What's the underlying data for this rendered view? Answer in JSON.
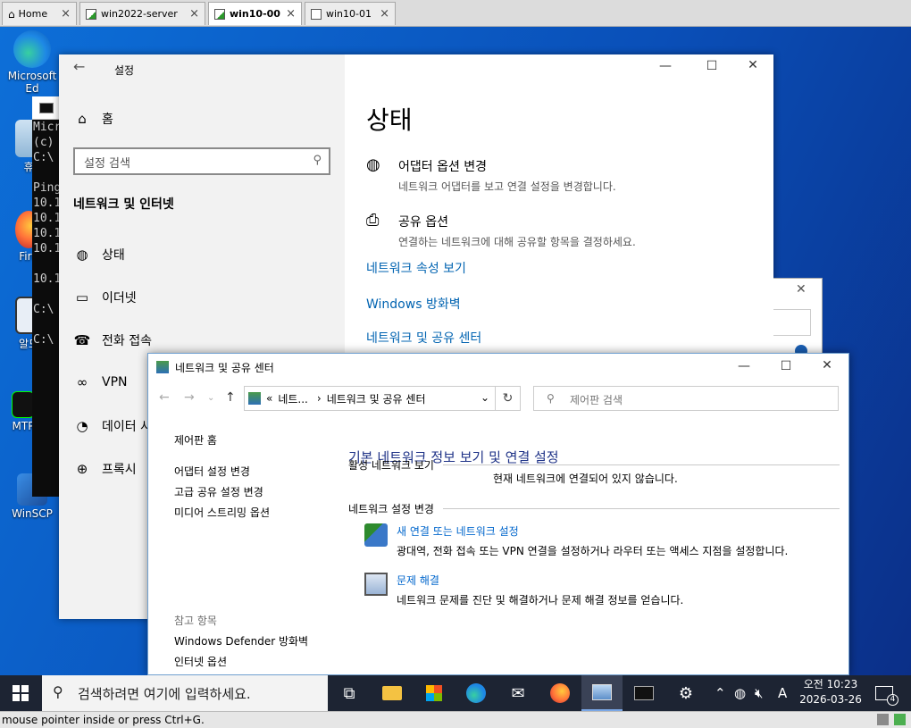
{
  "vm_tabs": [
    {
      "label": "Home"
    },
    {
      "label": "win2022-server"
    },
    {
      "label": "win10-00"
    },
    {
      "label": "win10-01"
    }
  ],
  "desktop_icons": [
    {
      "label": "Microsoft Ed"
    },
    {
      "label": "휴"
    },
    {
      "label": "Fire"
    },
    {
      "label": "알드"
    },
    {
      "label": "MTP"
    },
    {
      "label": "WinSCP"
    }
  ],
  "cmd": {
    "lines": [
      "Micr",
      "(c)",
      "C:\\",
      "",
      "Ping",
      "10.1",
      "10.1",
      "10.1",
      "10.1",
      "",
      "10.1",
      "",
      "C:\\",
      "",
      "C:\\"
    ]
  },
  "settings": {
    "title": "설정",
    "home": "홈",
    "search_placeholder": "설정 검색",
    "section": "네트워크 및 인터넷",
    "nav": [
      {
        "label": "상태",
        "icon": "globe-icon"
      },
      {
        "label": "이더넷",
        "icon": "ethernet-icon"
      },
      {
        "label": "전화 접속",
        "icon": "dialup-icon"
      },
      {
        "label": "VPN",
        "icon": "vpn-icon"
      },
      {
        "label": "데이터 사",
        "icon": "data-usage-icon"
      },
      {
        "label": "프록시",
        "icon": "proxy-icon"
      }
    ],
    "page_title": "상태",
    "rows": [
      {
        "title": "어댑터 옵션 변경",
        "desc": "네트워크 어댑터를 보고 연결 설정을 변경합니다."
      },
      {
        "title": "공유 옵션",
        "desc": "연결하는 네트워크에 대해 공유할 항목을 결정하세요."
      }
    ],
    "links": [
      "네트워크 속성 보기",
      "Windows 방화벽",
      "네트워크 및 공유 센터"
    ]
  },
  "netcenter": {
    "title": "네트워크 및 공유 센터",
    "breadcrumb": [
      "«",
      "네트...",
      "›",
      "네트워크 및 공유 센터"
    ],
    "search_placeholder": "제어판 검색",
    "sidebar": {
      "home": "제어판 홈",
      "links": [
        "어댑터 설정 변경",
        "고급 공유 설정 변경",
        "미디어 스트리밍 옵션"
      ],
      "see_also_title": "참고 항목",
      "see_also": [
        "Windows Defender 방화벽",
        "인터넷 옵션"
      ]
    },
    "main_title": "기본 네트워크 정보 보기 및 연결 설정",
    "active_networks_head": "활성 네트워크 보기",
    "not_connected": "현재 네트워크에 연결되어 있지 않습니다.",
    "change_settings_head": "네트워크 설정 변경",
    "tasks": [
      {
        "title": "새 연결 또는 네트워크 설정",
        "desc": "광대역, 전화 접속 또는 VPN 연결을 설정하거나 라우터 또는 액세스 지점을 설정합니다."
      },
      {
        "title": "문제 해결",
        "desc": "네트워크 문제를 진단 및 해결하거나 문제 해결 정보를 얻습니다."
      }
    ]
  },
  "taskbar": {
    "search_placeholder": "검색하려면 여기에 입력하세요.",
    "ime": "A",
    "clock_time": "오전 10:23",
    "clock_date": "2026-03-26",
    "notification_count": "4"
  },
  "statusbar": {
    "text": "mouse pointer inside or press Ctrl+G."
  }
}
